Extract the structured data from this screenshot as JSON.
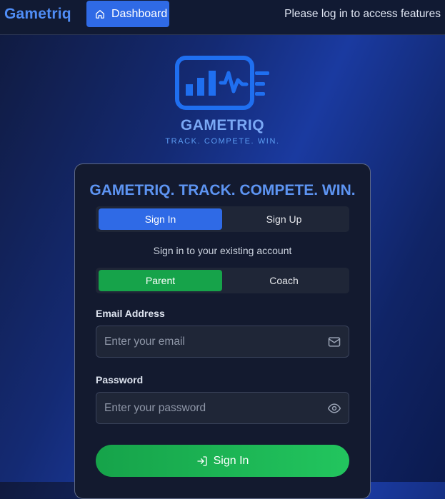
{
  "nav": {
    "brand": "Gametriq",
    "dashboard_label": "Dashboard",
    "dashboard_icon": "home-icon",
    "login_note": "Please log in to access features"
  },
  "logo": {
    "title": "GAMETRIQ",
    "tagline": "TRACK. COMPETE. WIN."
  },
  "card": {
    "heading": "GAMETRIQ. TRACK. COMPETE. WIN.",
    "auth_tabs": [
      {
        "label": "Sign In",
        "active": true
      },
      {
        "label": "Sign Up",
        "active": false
      }
    ],
    "subtext": "Sign in to your existing account",
    "role_tabs": [
      {
        "label": "Parent",
        "active": true
      },
      {
        "label": "Coach",
        "active": false
      }
    ],
    "email": {
      "label": "Email Address",
      "placeholder": "Enter your email",
      "value": "",
      "icon": "mail-icon"
    },
    "password": {
      "label": "Password",
      "placeholder": "Enter your password",
      "value": "",
      "icon": "eye-icon"
    },
    "submit": {
      "label": "Sign In",
      "icon": "login-icon"
    }
  },
  "colors": {
    "accent_blue": "#2f6ae6",
    "accent_green": "#16a34a",
    "brand_text": "#4f8df6"
  }
}
